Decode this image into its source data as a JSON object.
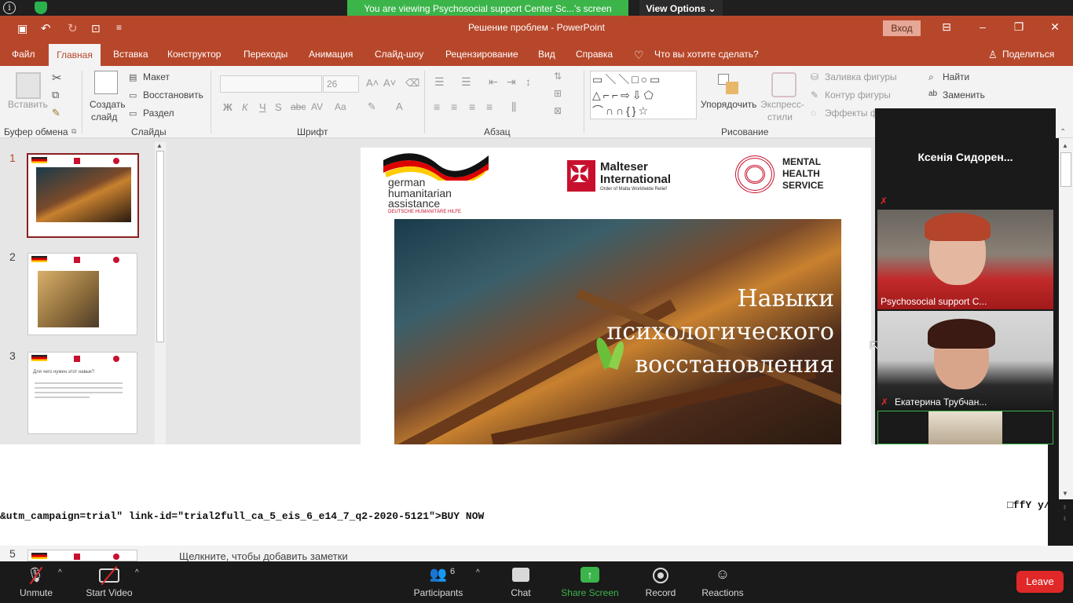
{
  "zoom": {
    "banner_text": "You are viewing Psychosocial support Center Sc...'s screen",
    "view_options_label": "View Options",
    "bottom": {
      "unmute_label": "Unmute",
      "start_video_label": "Start Video",
      "participants_label": "Participants",
      "participants_count": "6",
      "chat_label": "Chat",
      "share_screen_label": "Share Screen",
      "record_label": "Record",
      "reactions_label": "Reactions",
      "leave_label": "Leave"
    },
    "participants": {
      "top_name": "Ксенія Сидорен...",
      "video1_name": "Psychosocial support C...",
      "video2_name": "Екатерина Трубчан..."
    }
  },
  "powerpoint": {
    "doc_title": "Решение проблем  -  PowerPoint",
    "signin_label": "Вход",
    "tabs": [
      "Файл",
      "Главная",
      "Вставка",
      "Конструктор",
      "Переходы",
      "Анимация",
      "Слайд-шоу",
      "Рецензирование",
      "Вид",
      "Справка"
    ],
    "search_label": "Что вы хотите сделать?",
    "share_label": "Поделиться",
    "ribbon": {
      "paste": "Вставить",
      "clipboard_group": "Буфер обмена",
      "new_slide_1": "Создать",
      "new_slide_2": "слайд",
      "layout": "Макет",
      "reset": "Восстановить",
      "section": "Раздел",
      "slides_group": "Слайды",
      "font_size": "26",
      "font_group": "Шрифт",
      "paragraph_group": "Абзац",
      "arrange": "Упорядочить",
      "quick_styles_1": "Экспресс-",
      "quick_styles_2": "стили",
      "shape_fill": "Заливка фигуры",
      "shape_outline": "Контур фигуры",
      "shape_effects": "Эффекты ф",
      "drawing_group": "Рисование",
      "find": "Найти",
      "replace": "Заменить"
    },
    "slide_numbers": [
      "1",
      "2",
      "3",
      "5"
    ],
    "thumb3_title": "Для чего нужен этот навык?",
    "slide": {
      "logo_german_1": "german",
      "logo_german_2": "humanitarian",
      "logo_german_3": "assistance",
      "logo_german_4": "DEUTSCHE HUMANITÄRE HILFE",
      "logo_malteser_1": "Malteser",
      "logo_malteser_2": "International",
      "logo_malteser_3": "Order of Malta Worldwide Relief",
      "logo_mhs_1": "MENTAL",
      "logo_mhs_2": "HEALTH",
      "logo_mhs_3": "SERVICE",
      "title_line1": "Навыки психологического",
      "title_line2": "восстановления"
    },
    "notes_placeholder": "Щелкните, чтобы добавить заметки"
  },
  "overlay": {
    "code_text": "&utm_campaign=trial\" link-id=\"trial2full_ca_5_eis_6_e14_7_q2-2020-5121\">BUY NOW",
    "code_right": "□ffY y/"
  },
  "colors": {
    "ppt_accent": "#b7472a",
    "zoom_green": "#3bb54a",
    "leave_red": "#e02828"
  }
}
